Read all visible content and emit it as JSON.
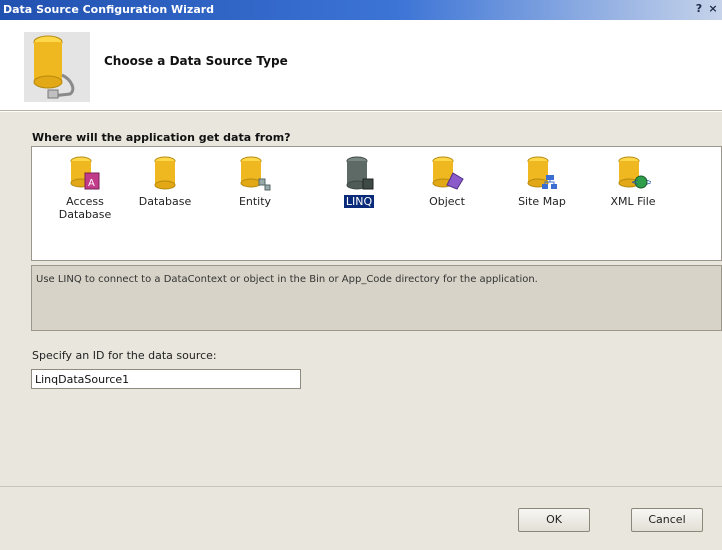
{
  "window": {
    "title": "Data Source Configuration Wizard",
    "help_button": "?",
    "close_button": "×"
  },
  "header": {
    "title": "Choose a Data Source Type"
  },
  "types": {
    "question": "Where will the application get data from?",
    "items": [
      {
        "label": "Access Database",
        "icon": "access-database-icon",
        "selected": false
      },
      {
        "label": "Database",
        "icon": "database-icon",
        "selected": false
      },
      {
        "label": "Entity",
        "icon": "entity-icon",
        "selected": false
      },
      {
        "label": "LINQ",
        "icon": "linq-icon",
        "selected": true
      },
      {
        "label": "Object",
        "icon": "object-icon",
        "selected": false
      },
      {
        "label": "Site Map",
        "icon": "site-map-icon",
        "selected": false
      },
      {
        "label": "XML File",
        "icon": "xml-file-icon",
        "selected": false
      }
    ],
    "description": "Use LINQ to connect to a DataContext or object in the Bin or App_Code directory for the application."
  },
  "id_field": {
    "label": "Specify an ID for the data source:",
    "value": "LinqDataSource1"
  },
  "buttons": {
    "ok": "OK",
    "cancel": "Cancel"
  },
  "colors": {
    "titlebar_start": "#2151b0",
    "selection": "#0a2b7a",
    "cylinder": "#f0b820",
    "linq_cylinder": "#5d6a66"
  }
}
